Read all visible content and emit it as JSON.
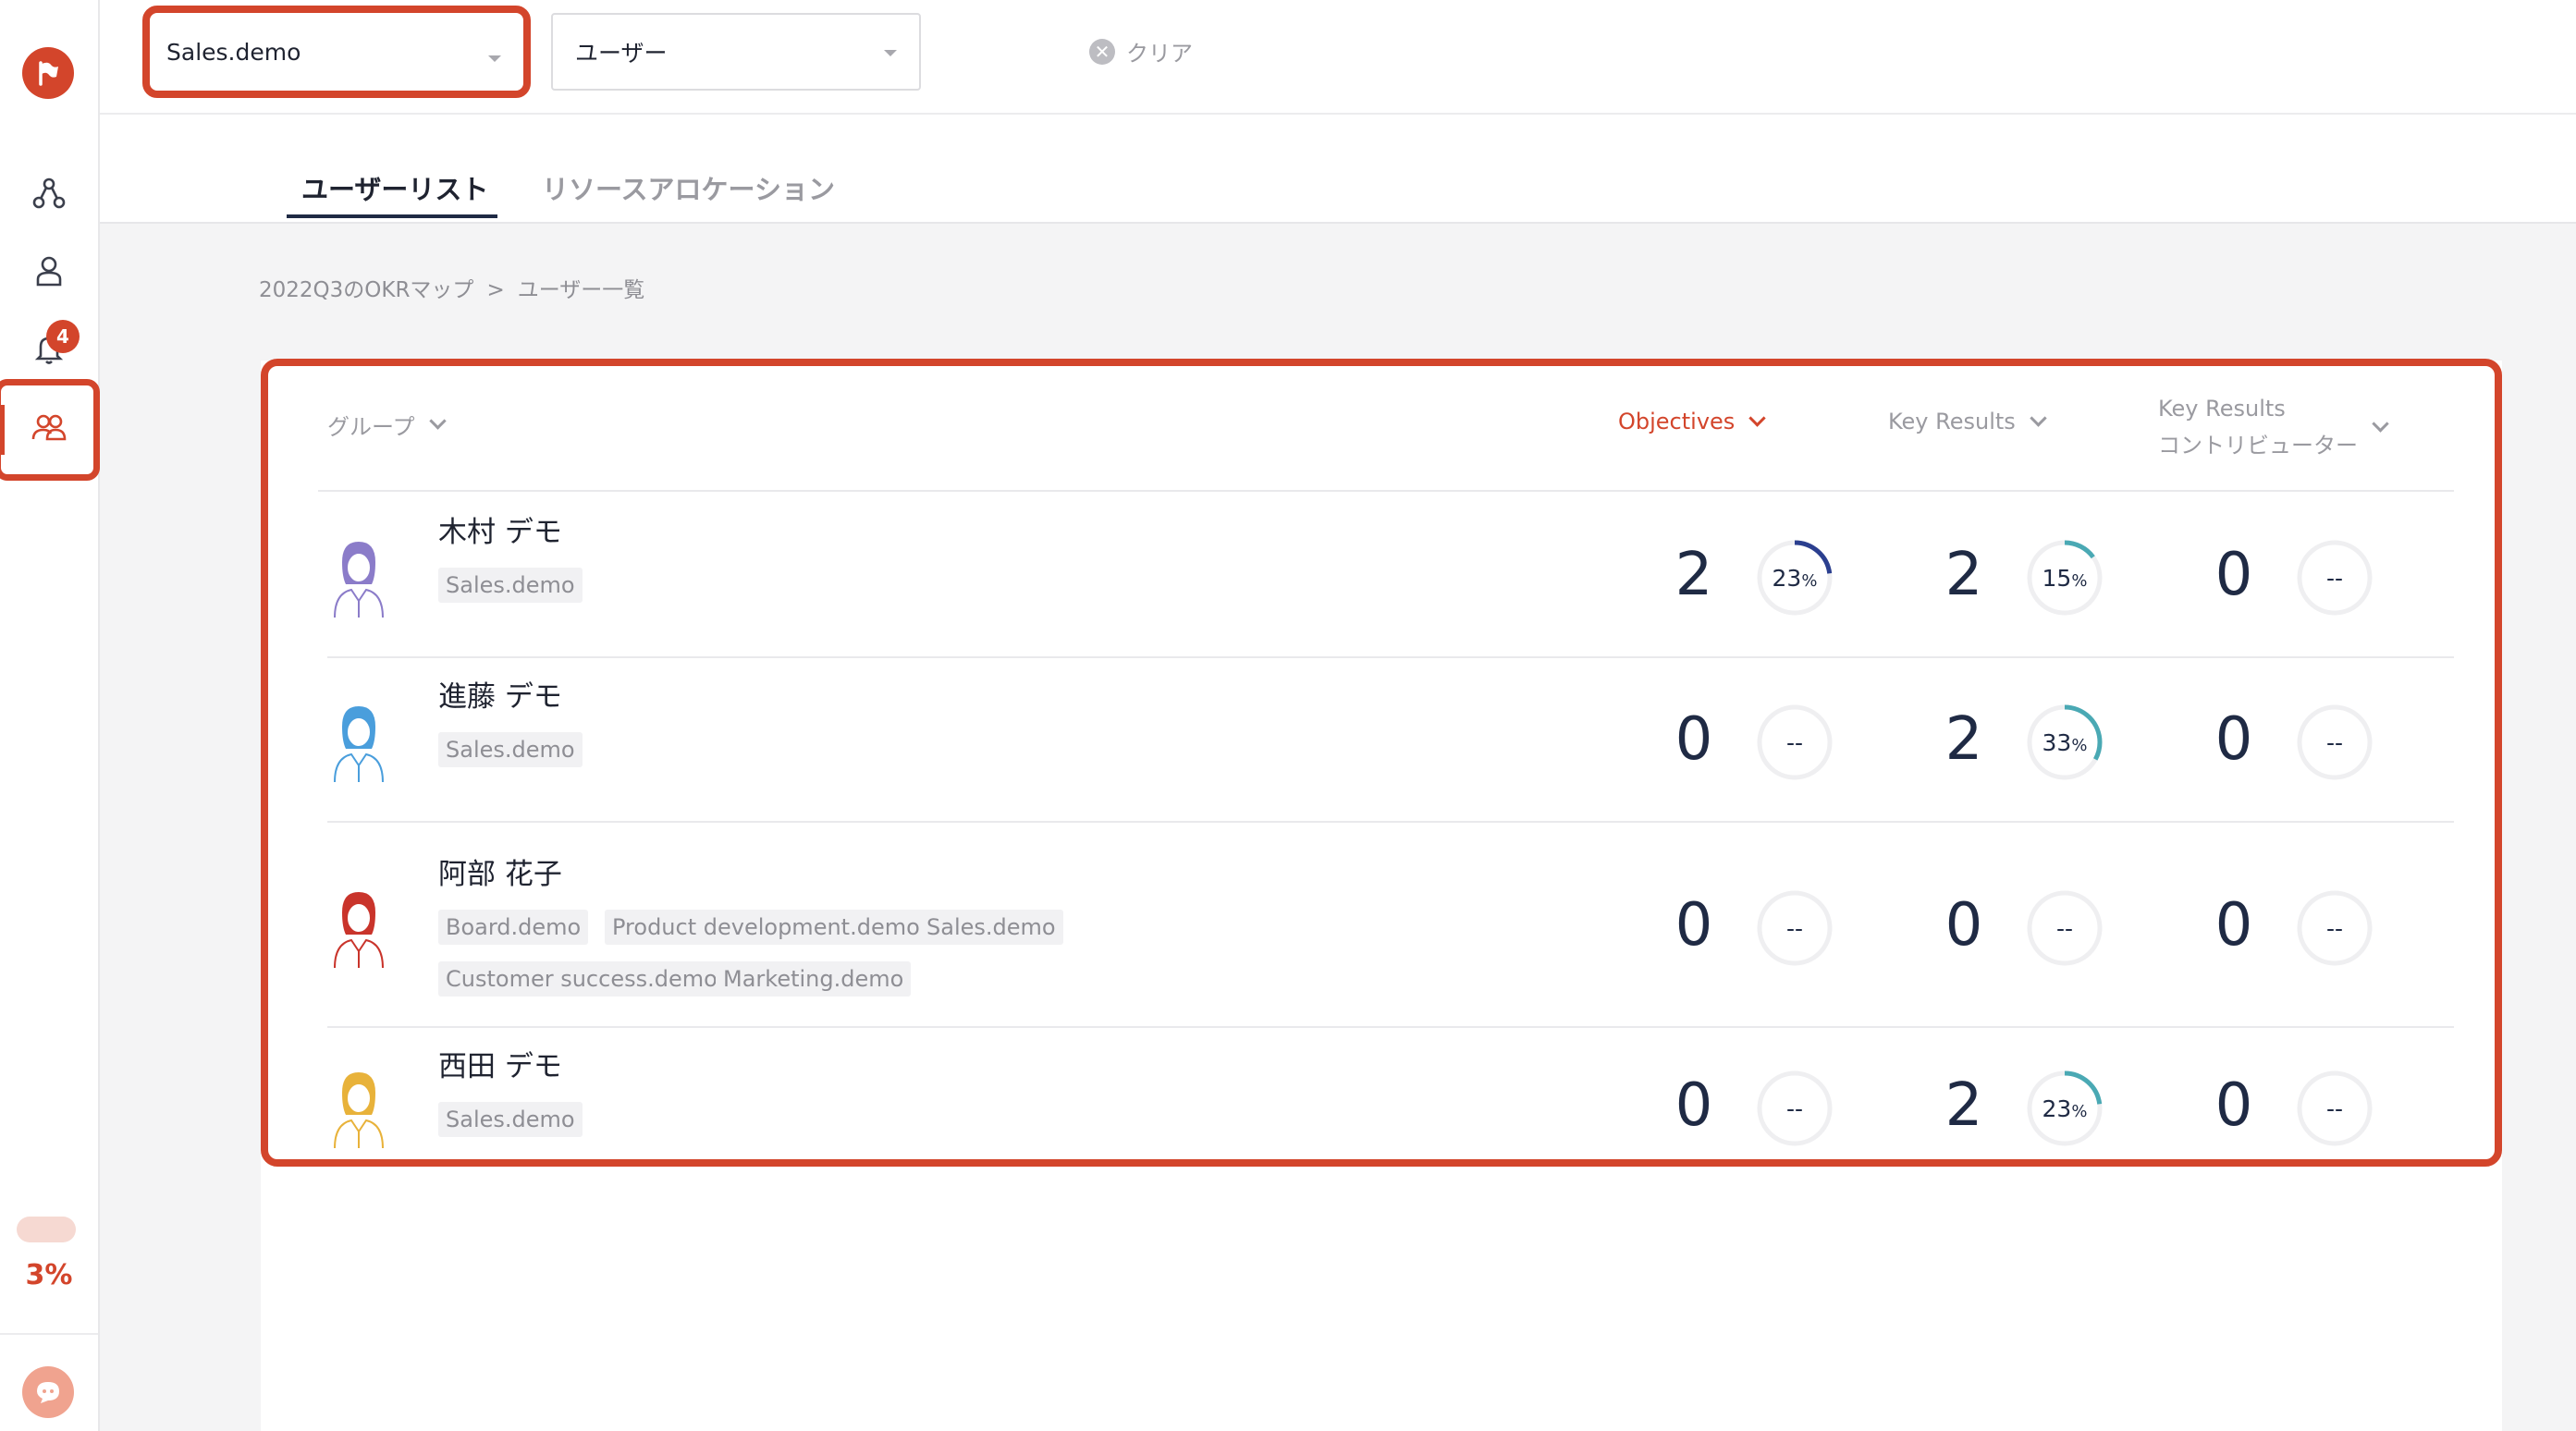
{
  "colors": {
    "accent": "#d3452b",
    "navy": "#2b3f8f",
    "teal": "#4aa9b4"
  },
  "sidebar": {
    "notification_count": "4",
    "progress_percent": "3%",
    "progress_fraction": 0.03
  },
  "topbar": {
    "group_select": "Sales.demo",
    "user_select": "ユーザー",
    "clear_label": "クリア"
  },
  "tabs": [
    {
      "label": "ユーザーリスト",
      "active": true
    },
    {
      "label": "リソースアロケーション",
      "active": false
    }
  ],
  "breadcrumb": {
    "map": "2022Q3のOKRマップ",
    "separator": ">",
    "current": "ユーザー一覧"
  },
  "table": {
    "headers": {
      "group": "グループ",
      "objectives": "Objectives",
      "key_results": "Key Results",
      "kr_contrib_line1": "Key Results",
      "kr_contrib_line2": "コントリビューター"
    },
    "rows": [
      {
        "name": "木村 デモ",
        "avatar": "purple",
        "tags": [
          "Sales.demo"
        ],
        "obj_count": "2",
        "obj_pct": "23",
        "obj_ring_fraction": 0.23,
        "kr_count": "2",
        "kr_pct": "15",
        "kr_ring_fraction": 0.15,
        "contrib_count": "0",
        "contrib_pct": "--"
      },
      {
        "name": "進藤 デモ",
        "avatar": "blue",
        "tags": [
          "Sales.demo"
        ],
        "obj_count": "0",
        "obj_pct": "--",
        "kr_count": "2",
        "kr_pct": "33",
        "kr_ring_fraction": 0.33,
        "contrib_count": "0",
        "contrib_pct": "--"
      },
      {
        "name": "阿部 花子",
        "avatar": "red",
        "tags": [
          "Board.demo",
          "Product development.demo",
          "Sales.demo",
          "Customer success.demo",
          "Marketing.demo"
        ],
        "obj_count": "0",
        "obj_pct": "--",
        "kr_count": "0",
        "kr_pct": "--",
        "contrib_count": "0",
        "contrib_pct": "--"
      },
      {
        "name": "西田 デモ",
        "avatar": "yellow",
        "tags": [
          "Sales.demo"
        ],
        "obj_count": "0",
        "obj_pct": "--",
        "kr_count": "2",
        "kr_pct": "23",
        "kr_ring_fraction": 0.23,
        "contrib_count": "0",
        "contrib_pct": "--"
      }
    ],
    "percent_sign": "%"
  }
}
